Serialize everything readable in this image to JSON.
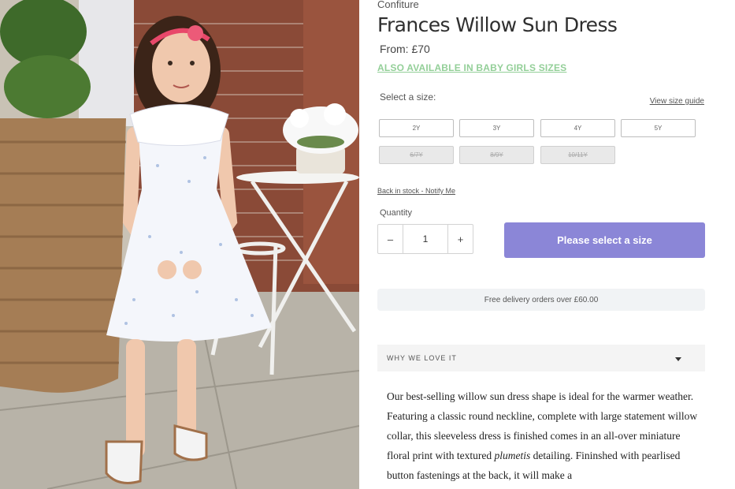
{
  "product": {
    "brand": "Confiture",
    "title": "Frances Willow Sun Dress",
    "price": "From: £70",
    "baby_sizes_link": "ALSO AVAILABLE IN BABY GIRLS SIZES"
  },
  "sizes": {
    "label": "Select a size:",
    "guide_link": "View size guide",
    "options": [
      {
        "label": "2Y",
        "available": true
      },
      {
        "label": "3Y",
        "available": true
      },
      {
        "label": "4Y",
        "available": true
      },
      {
        "label": "5Y",
        "available": true
      },
      {
        "label": "6/7Y",
        "available": false
      },
      {
        "label": "8/9Y",
        "available": false
      },
      {
        "label": "10/11Y",
        "available": false
      }
    ],
    "notify_link": "Back in stock - Notify Me"
  },
  "quantity": {
    "label": "Quantity",
    "value": "1",
    "decrement": "–",
    "increment": "+"
  },
  "cta": {
    "label": "Please select a size",
    "color": "#8b86d7"
  },
  "delivery_banner": "Free delivery orders over £60.00",
  "accordion": {
    "title": "WHY WE LOVE IT",
    "icon": "chevron-down-icon",
    "description": {
      "part1": "Our best-selling willow sun dress shape is ideal for the warmer weather. Featuring a classic round neckline, complete with large statement willow collar, this sleeveless dress is finished comes in an all-over miniature floral print with textured ",
      "emphasis": "plumetis",
      "part2": " detailing. Fininshed with pearlised button fastenings at the back, it will make a"
    }
  },
  "colors": {
    "link_green": "#93cf98",
    "accent_purple": "#8b86d7"
  }
}
